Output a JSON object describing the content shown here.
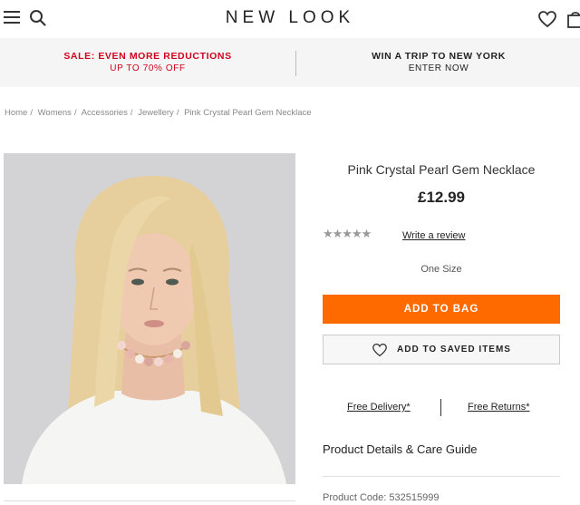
{
  "header": {
    "logo": "NEW LOOK",
    "menu_icon": "hamburger-menu-icon",
    "search_icon": "search-icon",
    "saved_icon": "heart-icon",
    "bag_icon": "shopping-bag-icon"
  },
  "promo": {
    "left_line1": "SALE: EVEN MORE REDUCTIONS",
    "left_line2": "UP TO 70% OFF",
    "right_line1": "WIN A TRIP TO NEW YORK",
    "right_line2": "ENTER NOW",
    "sale_color": "#d0021b"
  },
  "breadcrumb": [
    "Home",
    "Womens",
    "Accessories",
    "Jewellery",
    "Pink Crystal Pearl Gem Necklace"
  ],
  "product": {
    "title": "Pink Crystal Pearl Gem Necklace",
    "price": "£12.99",
    "rating": 0,
    "rating_max": 5,
    "stars_text": "★★★★★",
    "review_link": "Write a review",
    "size": "One Size",
    "add_to_bag": "ADD TO BAG",
    "save_label": "ADD TO SAVED ITEMS",
    "free_delivery": "Free Delivery*",
    "free_returns": "Free Returns*",
    "details_heading": "Product Details & Care Guide",
    "product_code": "Product Code: 532515999",
    "accent_color": "#ff6a00"
  }
}
